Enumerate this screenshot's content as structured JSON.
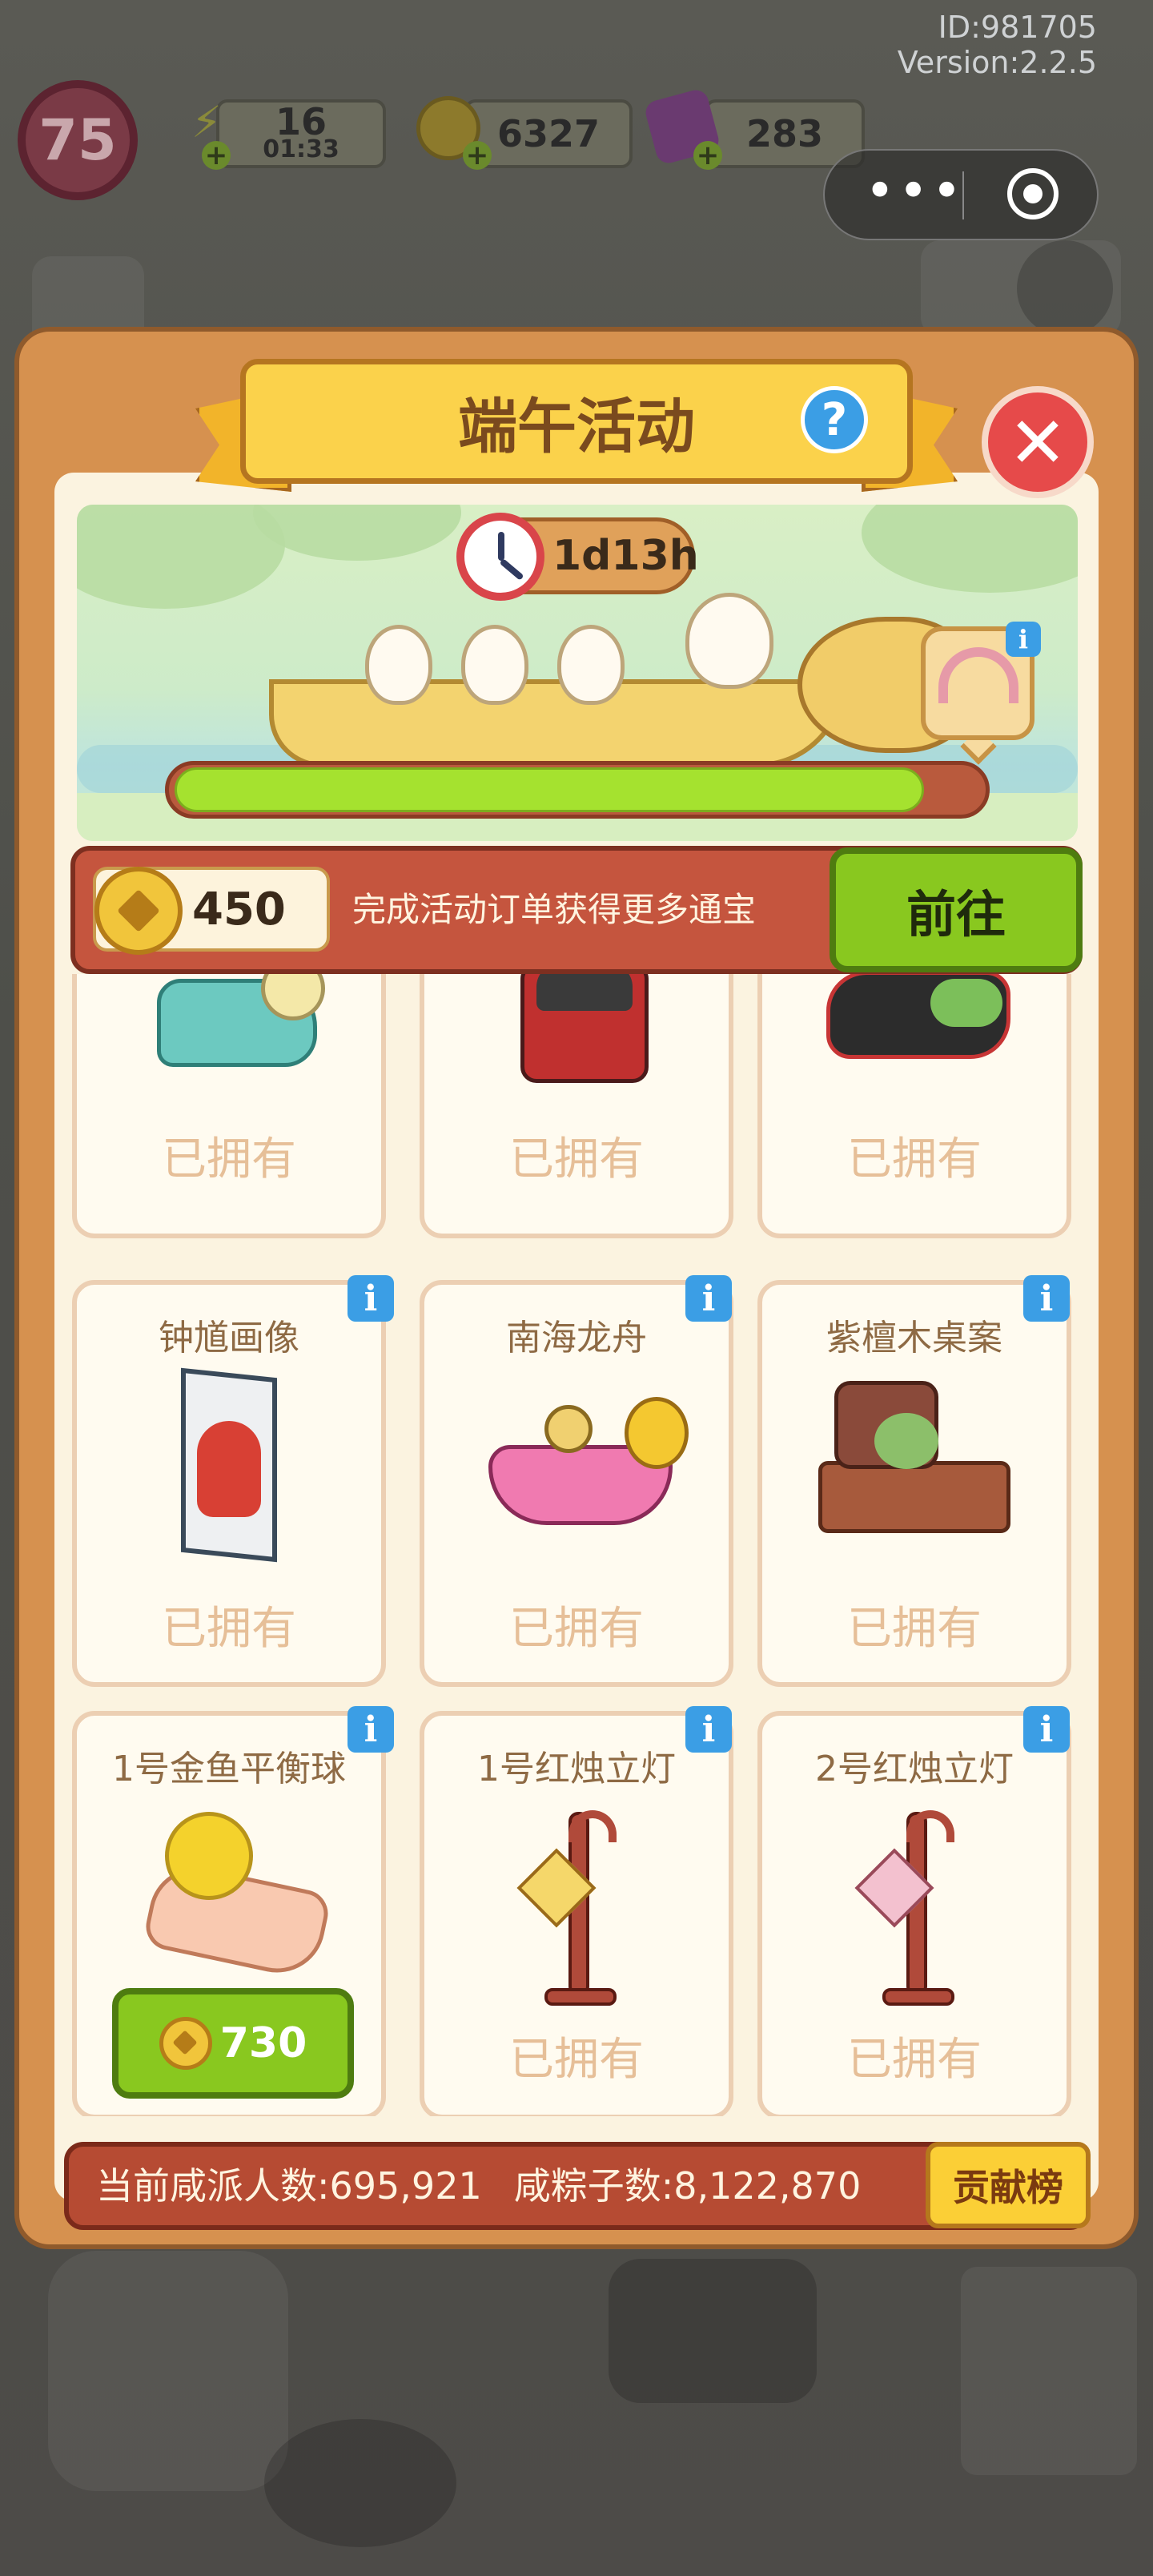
{
  "hud": {
    "id_text": "ID:981705",
    "version_text": "Version:2.2.5",
    "level": "75",
    "energy": "16",
    "energy_timer": "01:33",
    "coins": "6327",
    "gems": "283"
  },
  "panel": {
    "title": "端午活动",
    "help_symbol": "?",
    "close_symbol": "✕"
  },
  "event": {
    "timer": "1d13h",
    "progress": 0.93
  },
  "currency": {
    "amount": "450",
    "description": "完成活动订单获得更多通宝",
    "go_label": "前往"
  },
  "info_symbol": "i",
  "items": [
    {
      "name": "",
      "status": "已拥有"
    },
    {
      "name": "",
      "status": "已拥有"
    },
    {
      "name": "",
      "status": "已拥有"
    },
    {
      "name": "钟馗画像",
      "status": "已拥有"
    },
    {
      "name": "南海龙舟",
      "status": "已拥有"
    },
    {
      "name": "紫檀木桌案",
      "status": "已拥有"
    },
    {
      "name": "1号金鱼平衡球",
      "price": "730"
    },
    {
      "name": "1号红烛立灯",
      "status": "已拥有"
    },
    {
      "name": "2号红烛立灯",
      "status": "已拥有"
    }
  ],
  "stats": {
    "salty_label": "当前咸派人数:",
    "salty_value": "695,921",
    "zongzi_label": "咸粽子数:",
    "zongzi_value": "8,122,870",
    "rank_label": "贡献榜"
  },
  "colors": {
    "panel": "#d6914f",
    "go_button": "#89c81f",
    "progress_fill": "#a5e22f",
    "title_banner": "#fbd24b",
    "close_button": "#e64a4a",
    "info_button": "#3b9ee5"
  }
}
